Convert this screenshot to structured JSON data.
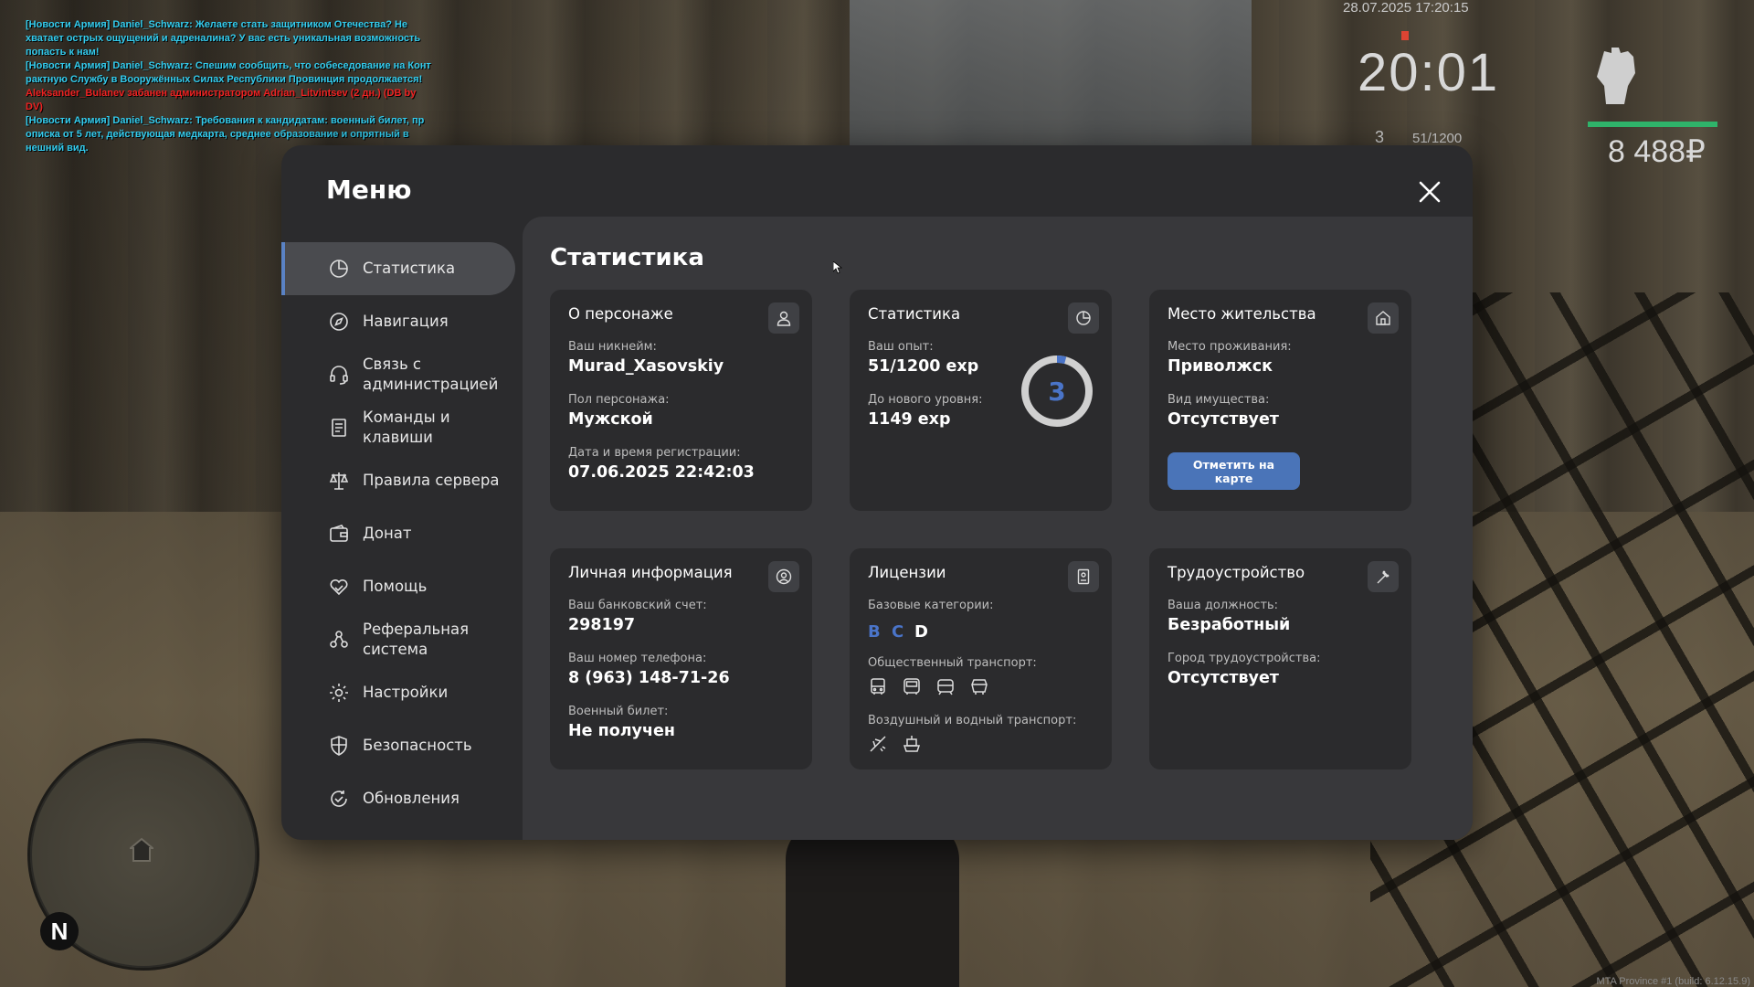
{
  "chat": [
    {
      "text": "[Новости Армия] Daniel_Schwarz: Желаете стать защитником Отечества? Не",
      "color": "#33ccee"
    },
    {
      "text": " хватает острых ощущений и адреналина? У вас есть уникальная возможность",
      "color": "#33ccee"
    },
    {
      "text": "попасть к нам!",
      "color": "#33ccee"
    },
    {
      "text": "[Новости Армия] Daniel_Schwarz: Спешим сообщить, что собеседование на Конт",
      "color": "#33ccee"
    },
    {
      "text": "рактную Службу в Вооружённых Силах Республики Провинция продолжается!",
      "color": "#33ccee"
    },
    {
      "text": "Aleksander_Bulanev забанен администратором Adrian_Litvintsev (2 дн.) (DB by",
      "color": "#ee2222"
    },
    {
      "text": " DV)",
      "color": "#ee2222"
    },
    {
      "text": "[Новости Армия] Daniel_Schwarz: Требования к кандидатам: военный билет, пр",
      "color": "#33ccee"
    },
    {
      "text": "описка от 5 лет, действующая медкарта, среднее образование и опрятный в",
      "color": "#33ccee"
    },
    {
      "text": "нешний вид.",
      "color": "#33ccee"
    }
  ],
  "hud": {
    "datetime": "28.07.2025 17:20:15",
    "time": "20:01",
    "level": "3",
    "xp": "51/1200",
    "money": "8 488₽",
    "build": "MTA Province #1 (build: 6.12.15.9)"
  },
  "radar": {
    "north_label": "N"
  },
  "menu": {
    "title": "Меню",
    "close_icon": "close-icon",
    "nav": [
      {
        "label": "Статистика",
        "icon": "pie-chart-icon",
        "active": true
      },
      {
        "label": "Навигация",
        "icon": "compass-icon"
      },
      {
        "label": "Связь с администрацией",
        "icon": "headset-icon"
      },
      {
        "label": "Команды и клавиши",
        "icon": "document-icon"
      },
      {
        "label": "Правила сервера",
        "icon": "scales-icon"
      },
      {
        "label": "Донат",
        "icon": "wallet-icon"
      },
      {
        "label": "Помощь",
        "icon": "heart-hand-icon"
      },
      {
        "label": "Реферальная система",
        "icon": "referral-icon"
      },
      {
        "label": "Настройки",
        "icon": "gear-icon"
      },
      {
        "label": "Безопасность",
        "icon": "shield-icon"
      },
      {
        "label": "Обновления",
        "icon": "refresh-check-icon"
      }
    ]
  },
  "stats": {
    "title": "Статистика",
    "character": {
      "title": "О персонаже",
      "nickname_label": "Ваш никнейм:",
      "nickname": "Murad_Xasovskiy",
      "gender_label": "Пол персонажа:",
      "gender": "Мужской",
      "reg_label": "Дата и время регистрации:",
      "reg_date": "07.06.2025 22:42:03"
    },
    "statistics": {
      "title": "Статистика",
      "exp_label": "Ваш опыт:",
      "exp": "51/1200 exp",
      "next_label": "До нового уровня:",
      "next": "1149 exp",
      "level": "3",
      "progress": 0.0425
    },
    "residence": {
      "title": "Место жительства",
      "place_label": "Место проживания:",
      "place": "Приволжск",
      "property_label": "Вид имущества:",
      "property": "Отсутствует",
      "map_button": "Отметить на карте"
    },
    "personal": {
      "title": "Личная информация",
      "bank_label": "Ваш банковский счет:",
      "bank": "298197",
      "phone_label": "Ваш номер телефона:",
      "phone": "8 (963) 148-71-26",
      "military_label": "Военный билет:",
      "military": "Не получен"
    },
    "licenses": {
      "title": "Лицензии",
      "basic_label": "Базовые категории:",
      "categories": [
        {
          "name": "B",
          "color": "#4a74c8"
        },
        {
          "name": "C",
          "color": "#4a74c8"
        },
        {
          "name": "D",
          "color": "#ffffff"
        }
      ],
      "public_label": "Общественный транспорт:",
      "public_icons": [
        "bus-icon",
        "bus-front-icon",
        "tram-icon",
        "trolleybus-icon"
      ],
      "air_label": "Воздушный и водный транспорт:",
      "air_icons": [
        "plane-icon",
        "ship-icon"
      ]
    },
    "employment": {
      "title": "Трудоустройство",
      "position_label": "Ваша должность:",
      "position": "Безработный",
      "city_label": "Город трудоустройства:",
      "city": "Отсутствует"
    }
  }
}
